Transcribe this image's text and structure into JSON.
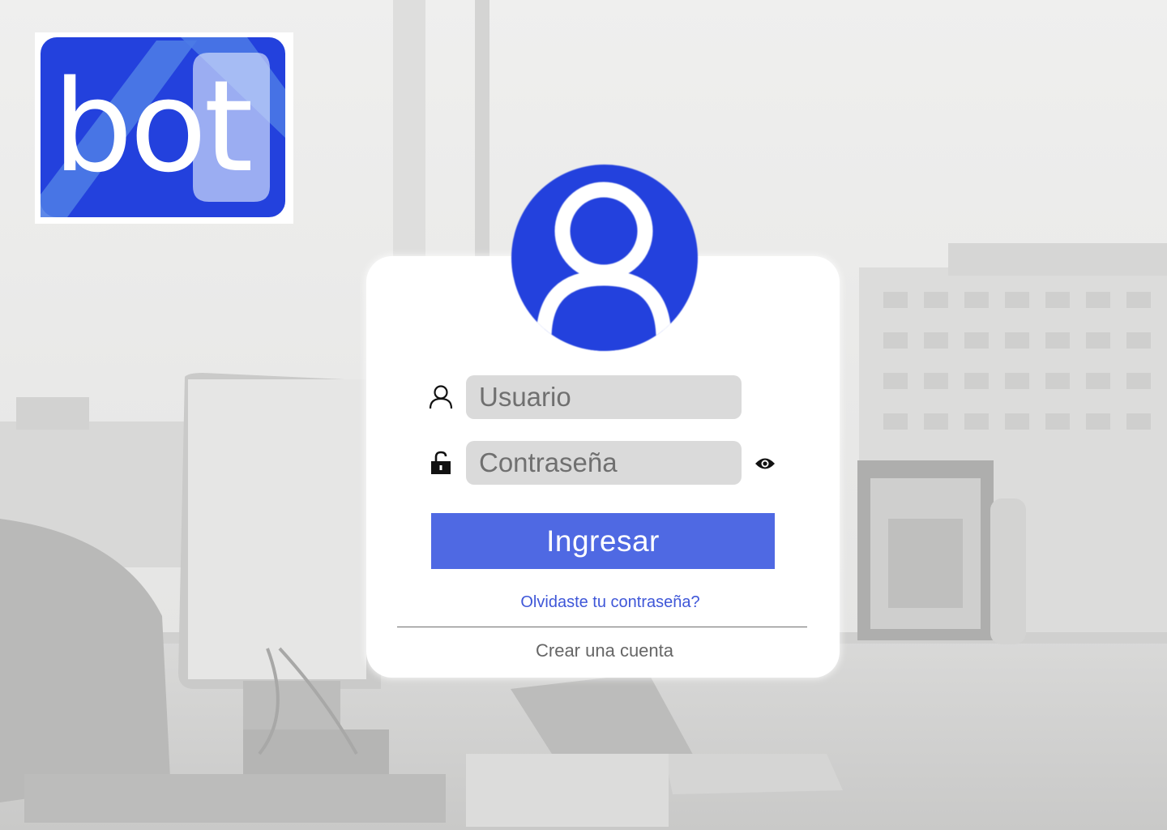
{
  "brand": {
    "logo_text": "bot",
    "logo_color": "#2341dd"
  },
  "login": {
    "avatar_icon": "user-avatar-icon",
    "username": {
      "icon": "user-icon",
      "placeholder": "Usuario",
      "value": ""
    },
    "password": {
      "icon": "unlock-icon",
      "placeholder": "Contraseña",
      "value": "",
      "toggle_icon": "eye-icon"
    },
    "submit_label": "Ingresar",
    "forgot_link": "Olvidaste tu contraseña?",
    "create_account": "Crear una cuenta"
  },
  "colors": {
    "accent": "#2341dd",
    "button": "#4f69e3",
    "link": "#3f57d8",
    "input_bg": "#dadada"
  }
}
